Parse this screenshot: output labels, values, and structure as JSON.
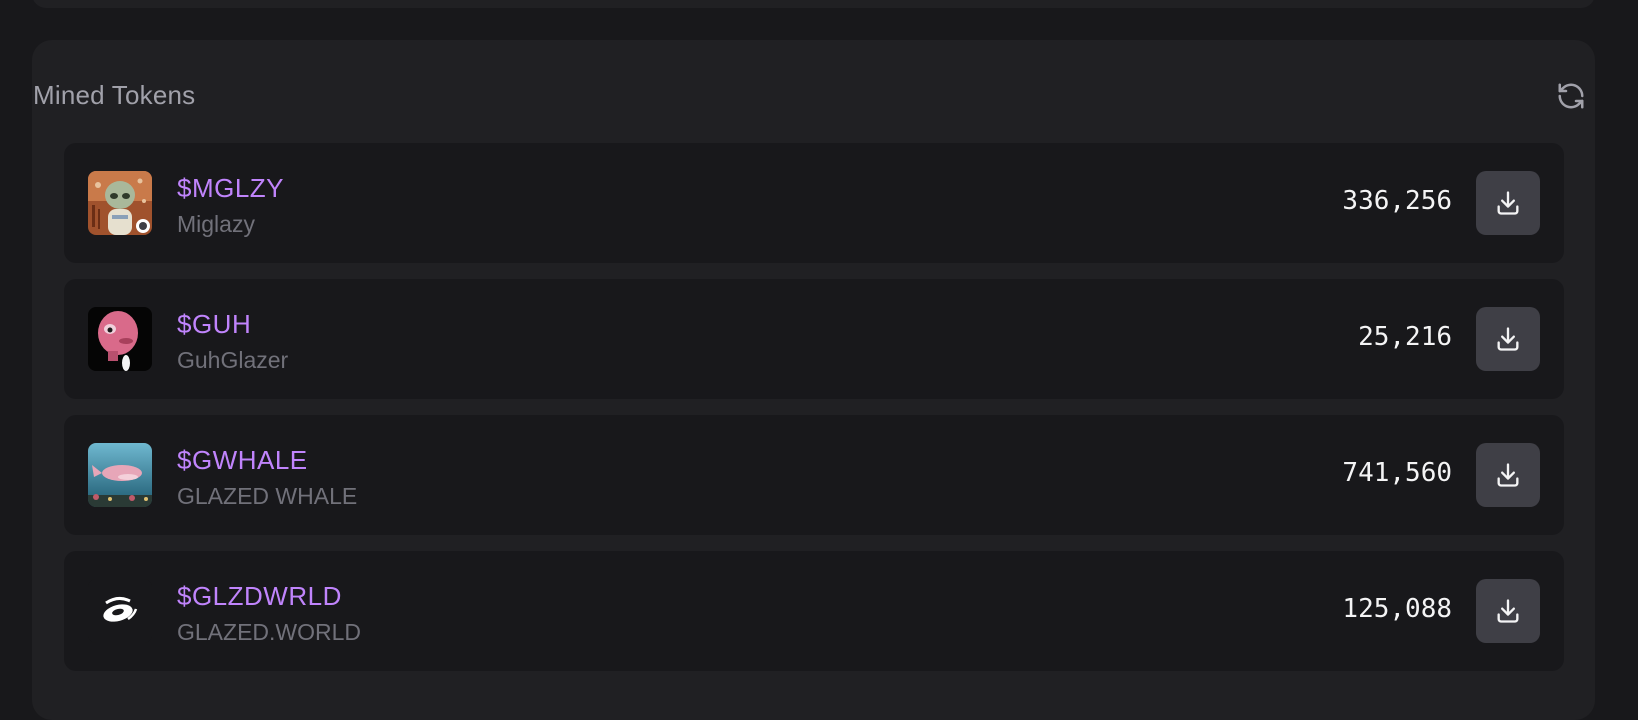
{
  "panel": {
    "title": "Mined Tokens",
    "refresh_icon": "refresh-icon"
  },
  "tokens": [
    {
      "symbol": "$MGLZY",
      "name": "Miglazy",
      "amount": "336,256",
      "avatar": "miglazy-avatar"
    },
    {
      "symbol": "$GUH",
      "name": "GuhGlazer",
      "amount": "25,216",
      "avatar": "guhglazer-avatar"
    },
    {
      "symbol": "$GWHALE",
      "name": "GLAZED WHALE",
      "amount": "741,560",
      "avatar": "glazed-whale-avatar"
    },
    {
      "symbol": "$GLZDWRLD",
      "name": "GLAZED.WORLD",
      "amount": "125,088",
      "avatar": "glazed-world-avatar"
    }
  ],
  "colors": {
    "background": "#18181b",
    "card": "#202023",
    "symbol": "#c084fc",
    "name": "#71717a",
    "amount": "#f4f4f5",
    "button": "#3f3f46"
  }
}
